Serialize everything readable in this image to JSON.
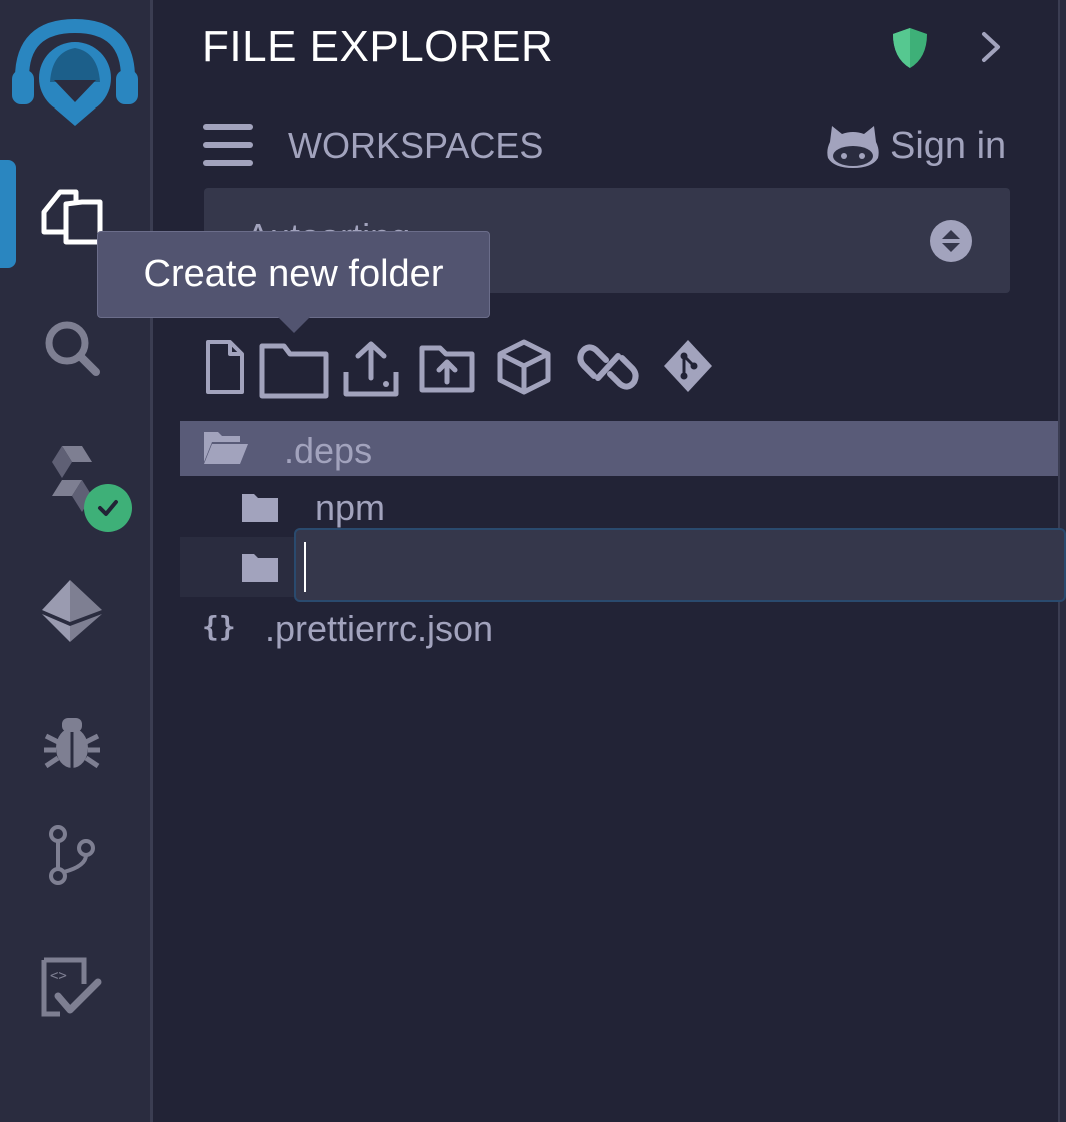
{
  "panel": {
    "title": "FILE EXPLORER",
    "workspaces_label": "WORKSPACES",
    "sign_in": "Sign in",
    "workspace_select_value": "Autoarting"
  },
  "tooltip": {
    "text": "Create new folder"
  },
  "icons": {
    "sidebar": [
      "remix-logo-icon",
      "file-explorer-icon",
      "search-icon",
      "solidity-compiler-icon",
      "deploy-run-icon",
      "debugger-icon",
      "git-icon",
      "unit-testing-icon"
    ],
    "toolbar": [
      "new-file-icon",
      "new-folder-icon",
      "upload-file-icon",
      "upload-folder-icon",
      "ipfs-icon",
      "link-icon",
      "git-clone-icon"
    ]
  },
  "tree": {
    "deps": ".deps",
    "npm": "npm",
    "new_folder_input": "",
    "prettierrc": ".prettierrc.json"
  },
  "colors": {
    "background": "#222336",
    "sidebar": "#2a2c3f",
    "accent": "#2a86c0",
    "selected_row": "#595b78",
    "text": "#a2a3bd",
    "success": "#3eb078"
  }
}
